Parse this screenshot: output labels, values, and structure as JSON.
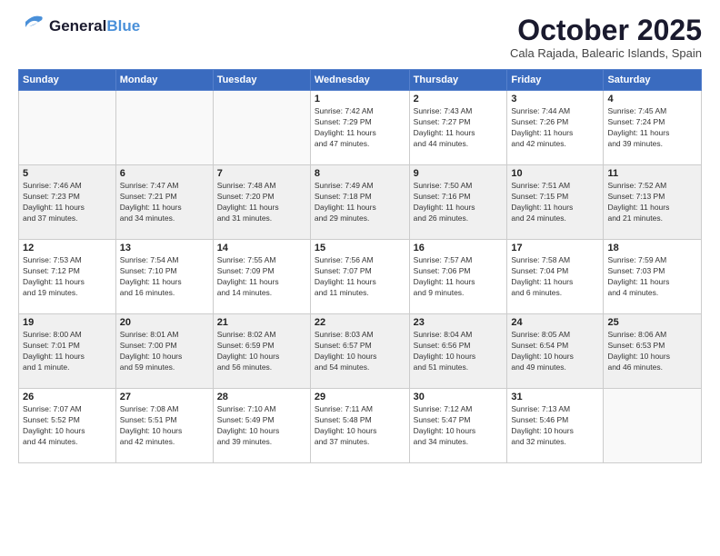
{
  "header": {
    "logo_general": "General",
    "logo_blue": "Blue",
    "month_title": "October 2025",
    "location": "Cala Rajada, Balearic Islands, Spain"
  },
  "days_of_week": [
    "Sunday",
    "Monday",
    "Tuesday",
    "Wednesday",
    "Thursday",
    "Friday",
    "Saturday"
  ],
  "weeks": [
    [
      {
        "day": "",
        "info": ""
      },
      {
        "day": "",
        "info": ""
      },
      {
        "day": "",
        "info": ""
      },
      {
        "day": "1",
        "info": "Sunrise: 7:42 AM\nSunset: 7:29 PM\nDaylight: 11 hours\nand 47 minutes."
      },
      {
        "day": "2",
        "info": "Sunrise: 7:43 AM\nSunset: 7:27 PM\nDaylight: 11 hours\nand 44 minutes."
      },
      {
        "day": "3",
        "info": "Sunrise: 7:44 AM\nSunset: 7:26 PM\nDaylight: 11 hours\nand 42 minutes."
      },
      {
        "day": "4",
        "info": "Sunrise: 7:45 AM\nSunset: 7:24 PM\nDaylight: 11 hours\nand 39 minutes."
      }
    ],
    [
      {
        "day": "5",
        "info": "Sunrise: 7:46 AM\nSunset: 7:23 PM\nDaylight: 11 hours\nand 37 minutes."
      },
      {
        "day": "6",
        "info": "Sunrise: 7:47 AM\nSunset: 7:21 PM\nDaylight: 11 hours\nand 34 minutes."
      },
      {
        "day": "7",
        "info": "Sunrise: 7:48 AM\nSunset: 7:20 PM\nDaylight: 11 hours\nand 31 minutes."
      },
      {
        "day": "8",
        "info": "Sunrise: 7:49 AM\nSunset: 7:18 PM\nDaylight: 11 hours\nand 29 minutes."
      },
      {
        "day": "9",
        "info": "Sunrise: 7:50 AM\nSunset: 7:16 PM\nDaylight: 11 hours\nand 26 minutes."
      },
      {
        "day": "10",
        "info": "Sunrise: 7:51 AM\nSunset: 7:15 PM\nDaylight: 11 hours\nand 24 minutes."
      },
      {
        "day": "11",
        "info": "Sunrise: 7:52 AM\nSunset: 7:13 PM\nDaylight: 11 hours\nand 21 minutes."
      }
    ],
    [
      {
        "day": "12",
        "info": "Sunrise: 7:53 AM\nSunset: 7:12 PM\nDaylight: 11 hours\nand 19 minutes."
      },
      {
        "day": "13",
        "info": "Sunrise: 7:54 AM\nSunset: 7:10 PM\nDaylight: 11 hours\nand 16 minutes."
      },
      {
        "day": "14",
        "info": "Sunrise: 7:55 AM\nSunset: 7:09 PM\nDaylight: 11 hours\nand 14 minutes."
      },
      {
        "day": "15",
        "info": "Sunrise: 7:56 AM\nSunset: 7:07 PM\nDaylight: 11 hours\nand 11 minutes."
      },
      {
        "day": "16",
        "info": "Sunrise: 7:57 AM\nSunset: 7:06 PM\nDaylight: 11 hours\nand 9 minutes."
      },
      {
        "day": "17",
        "info": "Sunrise: 7:58 AM\nSunset: 7:04 PM\nDaylight: 11 hours\nand 6 minutes."
      },
      {
        "day": "18",
        "info": "Sunrise: 7:59 AM\nSunset: 7:03 PM\nDaylight: 11 hours\nand 4 minutes."
      }
    ],
    [
      {
        "day": "19",
        "info": "Sunrise: 8:00 AM\nSunset: 7:01 PM\nDaylight: 11 hours\nand 1 minute."
      },
      {
        "day": "20",
        "info": "Sunrise: 8:01 AM\nSunset: 7:00 PM\nDaylight: 10 hours\nand 59 minutes."
      },
      {
        "day": "21",
        "info": "Sunrise: 8:02 AM\nSunset: 6:59 PM\nDaylight: 10 hours\nand 56 minutes."
      },
      {
        "day": "22",
        "info": "Sunrise: 8:03 AM\nSunset: 6:57 PM\nDaylight: 10 hours\nand 54 minutes."
      },
      {
        "day": "23",
        "info": "Sunrise: 8:04 AM\nSunset: 6:56 PM\nDaylight: 10 hours\nand 51 minutes."
      },
      {
        "day": "24",
        "info": "Sunrise: 8:05 AM\nSunset: 6:54 PM\nDaylight: 10 hours\nand 49 minutes."
      },
      {
        "day": "25",
        "info": "Sunrise: 8:06 AM\nSunset: 6:53 PM\nDaylight: 10 hours\nand 46 minutes."
      }
    ],
    [
      {
        "day": "26",
        "info": "Sunrise: 7:07 AM\nSunset: 5:52 PM\nDaylight: 10 hours\nand 44 minutes."
      },
      {
        "day": "27",
        "info": "Sunrise: 7:08 AM\nSunset: 5:51 PM\nDaylight: 10 hours\nand 42 minutes."
      },
      {
        "day": "28",
        "info": "Sunrise: 7:10 AM\nSunset: 5:49 PM\nDaylight: 10 hours\nand 39 minutes."
      },
      {
        "day": "29",
        "info": "Sunrise: 7:11 AM\nSunset: 5:48 PM\nDaylight: 10 hours\nand 37 minutes."
      },
      {
        "day": "30",
        "info": "Sunrise: 7:12 AM\nSunset: 5:47 PM\nDaylight: 10 hours\nand 34 minutes."
      },
      {
        "day": "31",
        "info": "Sunrise: 7:13 AM\nSunset: 5:46 PM\nDaylight: 10 hours\nand 32 minutes."
      },
      {
        "day": "",
        "info": ""
      }
    ]
  ],
  "row_styles": [
    "row-white",
    "row-shaded",
    "row-white",
    "row-shaded",
    "row-white"
  ]
}
